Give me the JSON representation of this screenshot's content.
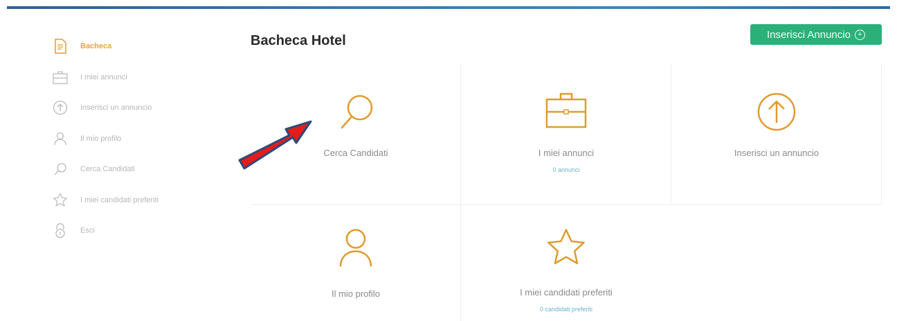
{
  "page": {
    "title": "Bacheca Hotel"
  },
  "header": {
    "add_button_label": "Inserisci Annuncio"
  },
  "colors": {
    "accent": "#e09b2d",
    "button_green": "#2cb07a",
    "link_blue": "#6cb3cf",
    "arrow_red": "#e41c1c",
    "arrow_outline": "#2b4a7a"
  },
  "sidebar": {
    "items": [
      {
        "label": "Bacheca",
        "icon": "document-icon",
        "active": true
      },
      {
        "label": "I miei annunci",
        "icon": "briefcase-icon",
        "active": false
      },
      {
        "label": "Inserisci un annuncio",
        "icon": "upload-circle-icon",
        "active": false
      },
      {
        "label": "Il mio profilo",
        "icon": "user-icon",
        "active": false
      },
      {
        "label": "Cerca Candidati",
        "icon": "search-icon",
        "active": false
      },
      {
        "label": "I miei candidati preferiti",
        "icon": "star-icon",
        "active": false
      },
      {
        "label": "Esci",
        "icon": "lock-icon",
        "active": false
      }
    ]
  },
  "tiles": [
    {
      "label": "Cerca Candidati",
      "sublabel": "",
      "icon": "search-icon"
    },
    {
      "label": "I miei annunci",
      "sublabel": "0 annunci",
      "icon": "briefcase-icon"
    },
    {
      "label": "Inserisci un annuncio",
      "sublabel": "",
      "icon": "upload-circle-icon"
    },
    {
      "label": "Il mio profilo",
      "sublabel": "",
      "icon": "user-icon"
    },
    {
      "label": "I miei candidati preferiti",
      "sublabel": "0 candidati preferiti",
      "icon": "star-icon"
    }
  ]
}
